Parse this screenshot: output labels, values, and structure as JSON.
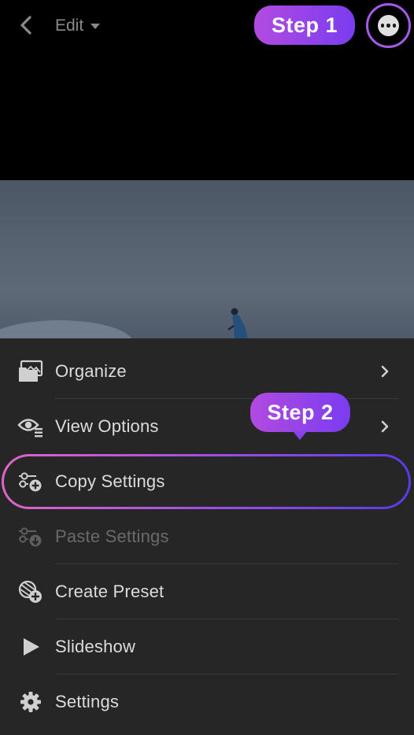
{
  "topbar": {
    "edit_label": "Edit",
    "step1_label": "Step 1"
  },
  "menu": {
    "items": [
      {
        "label": "Organize",
        "icon": "organize-icon",
        "disabled": false,
        "has_submenu": true
      },
      {
        "label": "View Options",
        "icon": "view-options-icon",
        "disabled": false,
        "has_submenu": true
      },
      {
        "label": "Copy Settings",
        "icon": "copy-settings-icon",
        "disabled": false,
        "has_submenu": false
      },
      {
        "label": "Paste Settings",
        "icon": "paste-settings-icon",
        "disabled": true,
        "has_submenu": false
      },
      {
        "label": "Create Preset",
        "icon": "create-preset-icon",
        "disabled": false,
        "has_submenu": false
      },
      {
        "label": "Slideshow",
        "icon": "play-icon",
        "disabled": false,
        "has_submenu": false
      },
      {
        "label": "Settings",
        "icon": "gear-icon",
        "disabled": false,
        "has_submenu": false
      }
    ],
    "step2_label": "Step 2"
  },
  "colors": {
    "badge_start": "#b24be0",
    "badge_end": "#7a3cf0",
    "highlight_start": "#e064c8",
    "highlight_end": "#5a3ae6",
    "menu_bg": "#262626"
  }
}
